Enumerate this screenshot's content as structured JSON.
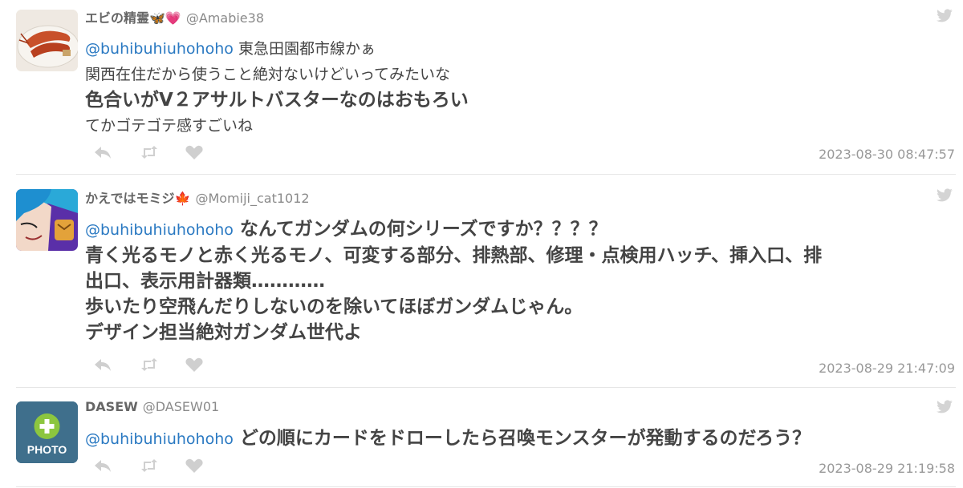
{
  "tweets": [
    {
      "display_name": "エビの精霊🦋💗",
      "handle": "@Amabie38",
      "mention": "@buhibuhiuhohoho",
      "lines": [
        "東急田園都市線かぁ",
        "関西在住だから使うこと絶対ないけどいってみたいな",
        "色合いがV２アサルトバスターなのはおもろい",
        "てかゴテゴテ感すごいね"
      ],
      "timestamp": "2023-08-30 08:47:57",
      "avatar": "shrimp-avatar"
    },
    {
      "display_name": "かえではモミジ🍁",
      "handle": "@Momiji_cat1012",
      "mention": "@buhibuhiuhohoho",
      "lines": [
        "なんてガンダムの何シリーズですか？？？？",
        "青く光るモノと赤く光るモノ、可変する部分、排熱部、修理・点検用ハッチ、挿入口、排",
        "出口、表示用計器類…………",
        "歩いたり空飛んだりしないのを除いてほぼガンダムじゃん。",
        "デザイン担当絶対ガンダム世代よ"
      ],
      "timestamp": "2023-08-29 21:47:09",
      "avatar": "anime-avatar"
    },
    {
      "display_name": "DASEW",
      "handle": "@DASEW01",
      "mention": "@buhibuhiuhohoho",
      "lines": [
        "どの順にカードをドローしたら召喚モンスターが発動するのだろう？"
      ],
      "timestamp": "2023-08-29 21:19:58",
      "avatar": "photo-placeholder-avatar",
      "avatar_label": "PHOTO"
    }
  ],
  "icons": {
    "reply": "reply-icon",
    "retweet": "retweet-icon",
    "like": "heart-icon",
    "brand": "twitter-bird-icon"
  },
  "colors": {
    "mention": "#2a79c2",
    "timestamp": "#999999",
    "action_icons": "#c8c8c8",
    "separator": "#e6e6e6"
  }
}
